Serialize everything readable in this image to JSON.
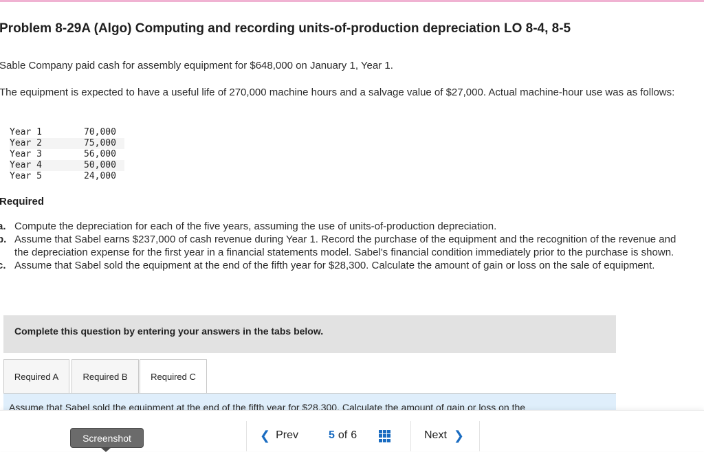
{
  "colors": {
    "accent": "#1a6cc1",
    "top_bar": "#f0b2d2",
    "tab_content_bg": "#dfeefb",
    "instruction_bg": "#e2e2e2"
  },
  "problem": {
    "title": "Problem 8-29A (Algo) Computing and recording units-of-production depreciation LO 8-4, 8-5",
    "intro": "Sable Company paid cash for assembly equipment for $648,000 on January 1, Year 1.",
    "details": "The equipment is expected to have a useful life of 270,000 machine hours and a salvage value of $27,000. Actual machine-hour use was as follows:",
    "usage": [
      {
        "year": "Year 1",
        "hours": "70,000"
      },
      {
        "year": "Year 2",
        "hours": "75,000"
      },
      {
        "year": "Year 3",
        "hours": "56,000"
      },
      {
        "year": "Year 4",
        "hours": "50,000"
      },
      {
        "year": "Year 5",
        "hours": "24,000"
      }
    ],
    "required_heading": "Required",
    "requirements": [
      {
        "marker": "a.",
        "text": "Compute the depreciation for each of the five years, assuming the use of units-of-production depreciation."
      },
      {
        "marker": "b.",
        "text": "Assume that Sabel earns $237,000 of cash revenue during Year 1. Record the purchase of the equipment and the recognition of the revenue and the depreciation expense for the first year in a financial statements model. Sabel's financial condition immediately prior to the purchase is shown."
      },
      {
        "marker": "c.",
        "text": "Assume that Sabel sold the equipment at the end of the fifth year for $28,300. Calculate the amount of gain or loss on the sale of equipment."
      }
    ]
  },
  "instruction": "Complete this question by entering your answers in the tabs below.",
  "tabs": [
    {
      "label": "Required A",
      "active": false
    },
    {
      "label": "Required B",
      "active": false
    },
    {
      "label": "Required C",
      "active": true
    }
  ],
  "tab_content": "Assume that Sabel sold the equipment at the end of the fifth year for $28,300. Calculate the amount of gain or loss on the",
  "footer": {
    "screenshot_label": "Screenshot",
    "prev_label": "Prev",
    "current_page": "5",
    "of_label": "of",
    "total_pages": "6",
    "next_label": "Next",
    "prev_icon": "chevron-left-icon",
    "next_icon": "chevron-right-icon",
    "grid_icon": "grid-icon"
  }
}
